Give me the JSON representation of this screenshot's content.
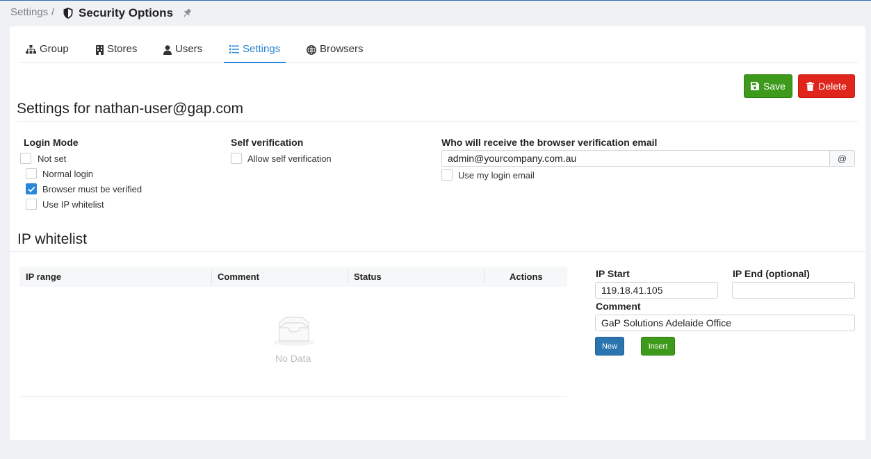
{
  "breadcrumb": {
    "root": "Settings",
    "separator": "/",
    "title": "Security Options"
  },
  "tabs": [
    {
      "label": "Group",
      "icon": "sitemap-icon"
    },
    {
      "label": "Stores",
      "icon": "building-icon"
    },
    {
      "label": "Users",
      "icon": "user-icon"
    },
    {
      "label": "Settings",
      "icon": "list-icon",
      "active": true
    },
    {
      "label": "Browsers",
      "icon": "globe-icon"
    }
  ],
  "actions": {
    "save": "Save",
    "delete": "Delete"
  },
  "settings": {
    "heading": "Settings for nathan-user@gap.com",
    "login_mode": {
      "label": "Login Mode",
      "options": [
        {
          "label": "Not set",
          "checked": false
        },
        {
          "label": "Normal login",
          "checked": false
        },
        {
          "label": "Browser must be verified",
          "checked": true
        },
        {
          "label": "Use IP whitelist",
          "checked": false
        }
      ]
    },
    "self_verification": {
      "label": "Self verification",
      "option": "Allow self verification",
      "checked": false
    },
    "email": {
      "label": "Who will receive the browser verification email",
      "value": "admin@yourcompany.com.au",
      "addon": "@",
      "use_login": "Use my login email",
      "use_login_checked": false
    }
  },
  "whitelist": {
    "heading": "IP whitelist",
    "columns": [
      "IP range",
      "Comment",
      "Status",
      "Actions"
    ],
    "empty_text": "No Data",
    "form": {
      "ip_start_label": "IP Start",
      "ip_start_value": "119.18.41.105",
      "ip_end_label": "IP End (optional)",
      "ip_end_value": "",
      "comment_label": "Comment",
      "comment_value": "GaP Solutions Adelaide Office",
      "new_button": "New",
      "insert_button": "Insert"
    }
  },
  "colors": {
    "accent": "#2a86d8",
    "save": "#3d9a1b",
    "delete": "#e0261c",
    "new": "#2a74b0"
  }
}
